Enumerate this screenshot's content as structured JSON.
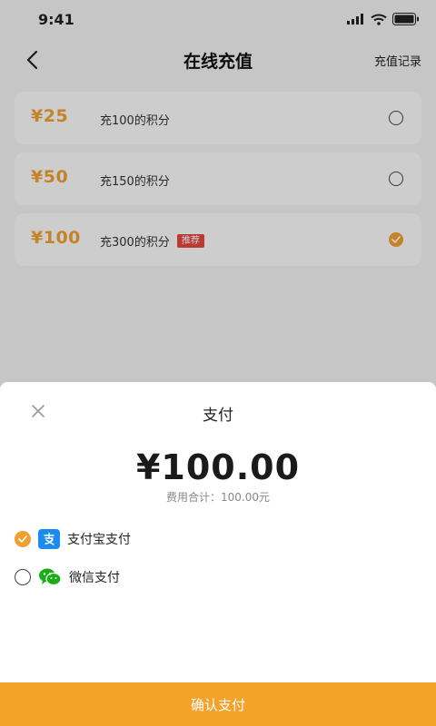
{
  "status": {
    "time": "9:41"
  },
  "nav": {
    "title": "在线充值",
    "record_label": "充值记录"
  },
  "plans": [
    {
      "price": "¥25",
      "desc": "充100的积分",
      "badge": "",
      "selected": false
    },
    {
      "price": "¥50",
      "desc": "充150的积分",
      "badge": "",
      "selected": false
    },
    {
      "price": "¥100",
      "desc": "充300的积分",
      "badge": "推荐",
      "selected": true
    }
  ],
  "payment_sheet": {
    "title": "支付",
    "amount": "¥100.00",
    "total_text": "费用合计：100.00元",
    "methods": [
      {
        "label": "支付宝支付",
        "icon": "alipay-icon",
        "selected": true
      },
      {
        "label": "微信支付",
        "icon": "wechat-icon",
        "selected": false
      }
    ],
    "confirm_label": "确认支付"
  },
  "colors": {
    "accent": "#f0a030",
    "badge": "#e5483f",
    "alipay": "#1a8cf0",
    "wechat": "#1aad19"
  }
}
